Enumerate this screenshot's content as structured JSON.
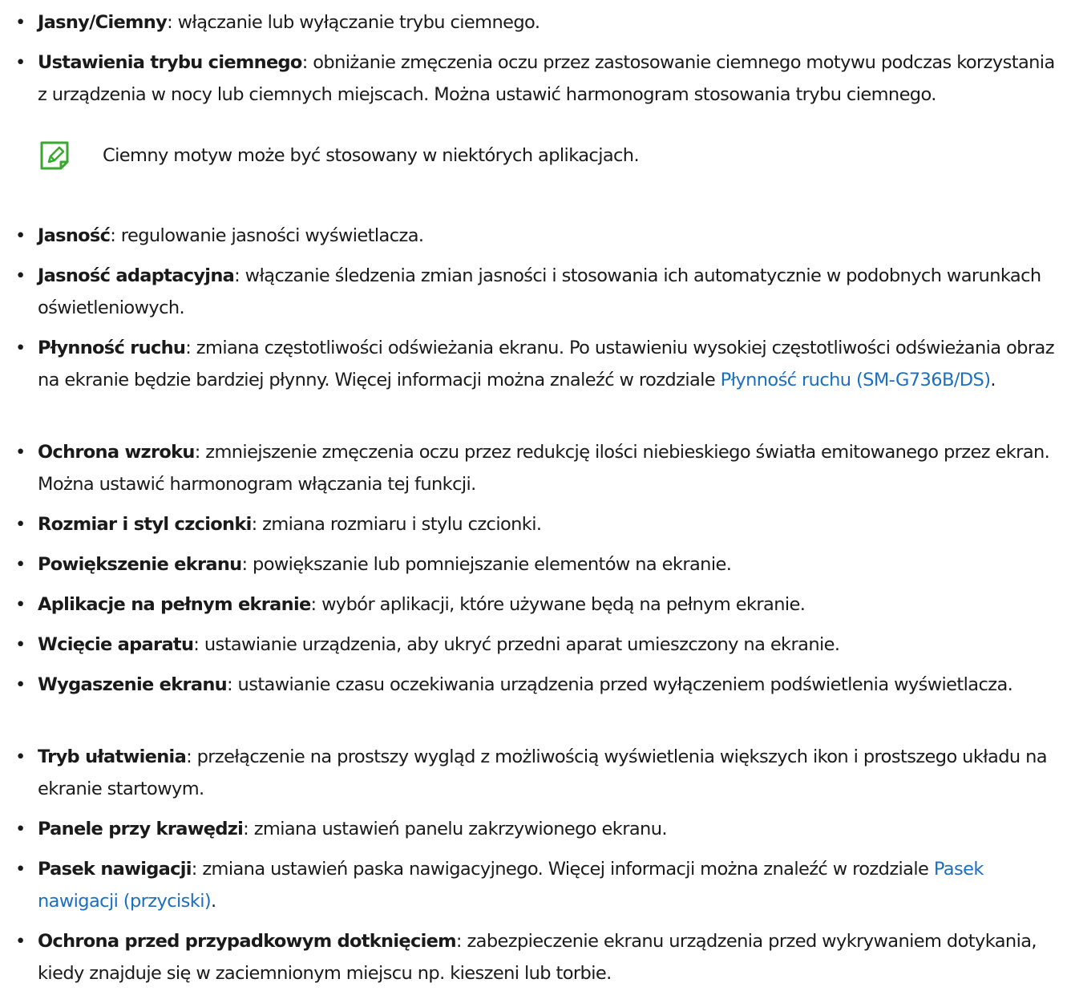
{
  "items": [
    {
      "term": "Jasny",
      "term_sep": "/",
      "term2": "Ciemny",
      "text": ": włączanie lub wyłączanie trybu ciemnego."
    },
    {
      "term": "Ustawienia trybu ciemnego",
      "text": ": obniżanie zmęczenia oczu przez zastosowanie ciemnego motywu podczas korzystania z urządzenia w nocy lub ciemnych miejscach. Można ustawić harmonogram stosowania trybu ciemnego."
    },
    {
      "term": "Jasność",
      "text": ": regulowanie jasności wyświetlacza."
    },
    {
      "term": "Jasność adaptacyjna",
      "text": ": włączanie śledzenia zmian jasności i stosowania ich automatycznie w podobnych warunkach oświetleniowych."
    },
    {
      "term": "Płynność ruchu",
      "text": ": zmiana częstotliwości odświeżania ekranu. Po ustawieniu wysokiej częstotliwości odświeżania obraz na ekranie będzie bardziej płynny. Więcej informacji można znaleźć w rozdziale ",
      "link": "Płynność ruchu (SM-G736B/DS)",
      "after": "."
    },
    {
      "term": "Ochrona wzroku",
      "text": ": zmniejszenie zmęczenia oczu przez redukcję ilości niebieskiego światła emitowanego przez ekran. Można ustawić harmonogram włączania tej funkcji."
    },
    {
      "term": "Rozmiar i styl czcionki",
      "text": ": zmiana rozmiaru i stylu czcionki."
    },
    {
      "term": "Powiększenie ekranu",
      "text": ": powiększanie lub pomniejszanie elementów na ekranie."
    },
    {
      "term": "Aplikacje na pełnym ekranie",
      "text": ": wybór aplikacji, które używane będą na pełnym ekranie."
    },
    {
      "term": "Wcięcie aparatu",
      "text": ": ustawianie urządzenia, aby ukryć przedni aparat umieszczony na ekranie."
    },
    {
      "term": "Wygaszenie ekranu",
      "text": ": ustawianie czasu oczekiwania urządzenia przed wyłączeniem podświetlenia wyświetlacza."
    },
    {
      "term": "Tryb ułatwienia",
      "text": ": przełączenie na prostszy wygląd z możliwością wyświetlenia większych ikon i prostszego układu na ekranie startowym."
    },
    {
      "term": "Panele przy krawędzi",
      "text": ": zmiana ustawień panelu zakrzywionego ekranu."
    },
    {
      "term": "Pasek nawigacji",
      "text": ": zmiana ustawień paska nawigacyjnego. Więcej informacji można znaleźć w rozdziale ",
      "link": "Pasek nawigacji (przyciski)",
      "after": "."
    },
    {
      "term": "Ochrona przed przypadkowym dotknięciem",
      "text": ": zabezpieczenie ekranu urządzenia przed wykrywaniem dotykania, kiedy znajduje się w zaciemnionym miejscu np. kieszeni lub torbie."
    }
  ],
  "note": {
    "icon": "note-pen-icon",
    "icon_color": "#3aa830",
    "text": "Ciemny motyw może być stosowany w niektórych aplikacjach."
  },
  "colors": {
    "text": "#1a1a1a",
    "link": "#1b6fc0"
  }
}
